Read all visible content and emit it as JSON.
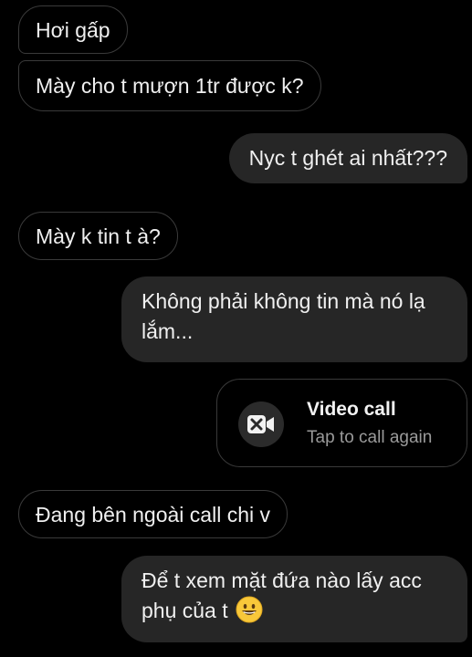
{
  "messages": [
    {
      "direction": "received",
      "text": "Hơi gấp"
    },
    {
      "direction": "received",
      "text": "Mày cho t mượn 1tr được k?"
    },
    {
      "direction": "sent",
      "text": "Nyc t ghét ai nhất???"
    },
    {
      "direction": "received",
      "text": "Mày k tin t à?"
    },
    {
      "direction": "sent",
      "text": "Không phải không tin mà nó lạ lắm..."
    },
    {
      "direction": "received",
      "text": "Đang bên ngoài call chi v"
    },
    {
      "direction": "sent",
      "text": "Để t xem mặt đứa nào lấy acc phụ của t",
      "emoji": "grinning-face"
    }
  ],
  "call": {
    "title": "Video call",
    "subtitle": "Tap to call again",
    "icon": "video-call-missed-icon"
  },
  "colors": {
    "background": "#000000",
    "sent_bubble": "#262626",
    "received_border": "#3a3a3a",
    "text": "#f0f0f0",
    "muted_text": "#9a9a9a"
  }
}
